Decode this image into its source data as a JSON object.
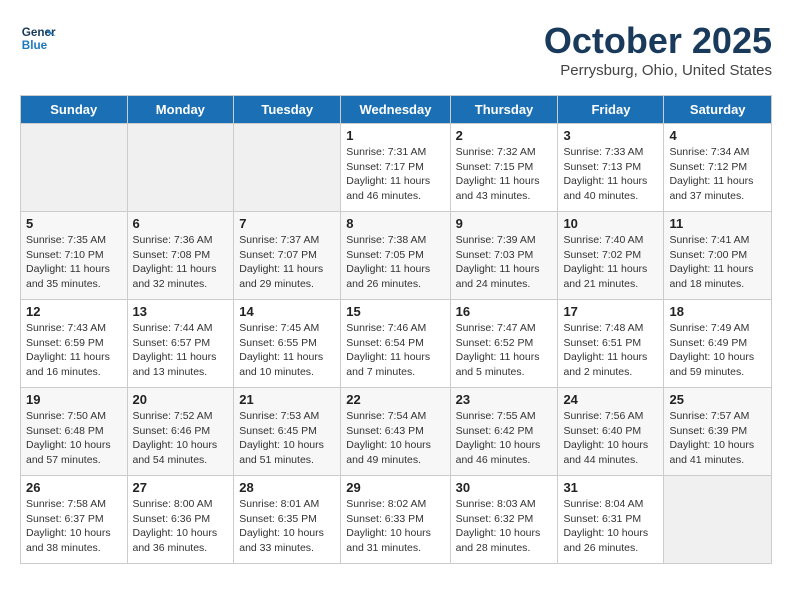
{
  "header": {
    "logo_line1": "General",
    "logo_line2": "Blue",
    "month": "October 2025",
    "location": "Perrysburg, Ohio, United States"
  },
  "weekdays": [
    "Sunday",
    "Monday",
    "Tuesday",
    "Wednesday",
    "Thursday",
    "Friday",
    "Saturday"
  ],
  "weeks": [
    [
      {
        "day": "",
        "info": ""
      },
      {
        "day": "",
        "info": ""
      },
      {
        "day": "",
        "info": ""
      },
      {
        "day": "1",
        "info": "Sunrise: 7:31 AM\nSunset: 7:17 PM\nDaylight: 11 hours and 46 minutes."
      },
      {
        "day": "2",
        "info": "Sunrise: 7:32 AM\nSunset: 7:15 PM\nDaylight: 11 hours and 43 minutes."
      },
      {
        "day": "3",
        "info": "Sunrise: 7:33 AM\nSunset: 7:13 PM\nDaylight: 11 hours and 40 minutes."
      },
      {
        "day": "4",
        "info": "Sunrise: 7:34 AM\nSunset: 7:12 PM\nDaylight: 11 hours and 37 minutes."
      }
    ],
    [
      {
        "day": "5",
        "info": "Sunrise: 7:35 AM\nSunset: 7:10 PM\nDaylight: 11 hours and 35 minutes."
      },
      {
        "day": "6",
        "info": "Sunrise: 7:36 AM\nSunset: 7:08 PM\nDaylight: 11 hours and 32 minutes."
      },
      {
        "day": "7",
        "info": "Sunrise: 7:37 AM\nSunset: 7:07 PM\nDaylight: 11 hours and 29 minutes."
      },
      {
        "day": "8",
        "info": "Sunrise: 7:38 AM\nSunset: 7:05 PM\nDaylight: 11 hours and 26 minutes."
      },
      {
        "day": "9",
        "info": "Sunrise: 7:39 AM\nSunset: 7:03 PM\nDaylight: 11 hours and 24 minutes."
      },
      {
        "day": "10",
        "info": "Sunrise: 7:40 AM\nSunset: 7:02 PM\nDaylight: 11 hours and 21 minutes."
      },
      {
        "day": "11",
        "info": "Sunrise: 7:41 AM\nSunset: 7:00 PM\nDaylight: 11 hours and 18 minutes."
      }
    ],
    [
      {
        "day": "12",
        "info": "Sunrise: 7:43 AM\nSunset: 6:59 PM\nDaylight: 11 hours and 16 minutes."
      },
      {
        "day": "13",
        "info": "Sunrise: 7:44 AM\nSunset: 6:57 PM\nDaylight: 11 hours and 13 minutes."
      },
      {
        "day": "14",
        "info": "Sunrise: 7:45 AM\nSunset: 6:55 PM\nDaylight: 11 hours and 10 minutes."
      },
      {
        "day": "15",
        "info": "Sunrise: 7:46 AM\nSunset: 6:54 PM\nDaylight: 11 hours and 7 minutes."
      },
      {
        "day": "16",
        "info": "Sunrise: 7:47 AM\nSunset: 6:52 PM\nDaylight: 11 hours and 5 minutes."
      },
      {
        "day": "17",
        "info": "Sunrise: 7:48 AM\nSunset: 6:51 PM\nDaylight: 11 hours and 2 minutes."
      },
      {
        "day": "18",
        "info": "Sunrise: 7:49 AM\nSunset: 6:49 PM\nDaylight: 10 hours and 59 minutes."
      }
    ],
    [
      {
        "day": "19",
        "info": "Sunrise: 7:50 AM\nSunset: 6:48 PM\nDaylight: 10 hours and 57 minutes."
      },
      {
        "day": "20",
        "info": "Sunrise: 7:52 AM\nSunset: 6:46 PM\nDaylight: 10 hours and 54 minutes."
      },
      {
        "day": "21",
        "info": "Sunrise: 7:53 AM\nSunset: 6:45 PM\nDaylight: 10 hours and 51 minutes."
      },
      {
        "day": "22",
        "info": "Sunrise: 7:54 AM\nSunset: 6:43 PM\nDaylight: 10 hours and 49 minutes."
      },
      {
        "day": "23",
        "info": "Sunrise: 7:55 AM\nSunset: 6:42 PM\nDaylight: 10 hours and 46 minutes."
      },
      {
        "day": "24",
        "info": "Sunrise: 7:56 AM\nSunset: 6:40 PM\nDaylight: 10 hours and 44 minutes."
      },
      {
        "day": "25",
        "info": "Sunrise: 7:57 AM\nSunset: 6:39 PM\nDaylight: 10 hours and 41 minutes."
      }
    ],
    [
      {
        "day": "26",
        "info": "Sunrise: 7:58 AM\nSunset: 6:37 PM\nDaylight: 10 hours and 38 minutes."
      },
      {
        "day": "27",
        "info": "Sunrise: 8:00 AM\nSunset: 6:36 PM\nDaylight: 10 hours and 36 minutes."
      },
      {
        "day": "28",
        "info": "Sunrise: 8:01 AM\nSunset: 6:35 PM\nDaylight: 10 hours and 33 minutes."
      },
      {
        "day": "29",
        "info": "Sunrise: 8:02 AM\nSunset: 6:33 PM\nDaylight: 10 hours and 31 minutes."
      },
      {
        "day": "30",
        "info": "Sunrise: 8:03 AM\nSunset: 6:32 PM\nDaylight: 10 hours and 28 minutes."
      },
      {
        "day": "31",
        "info": "Sunrise: 8:04 AM\nSunset: 6:31 PM\nDaylight: 10 hours and 26 minutes."
      },
      {
        "day": "",
        "info": ""
      }
    ]
  ]
}
